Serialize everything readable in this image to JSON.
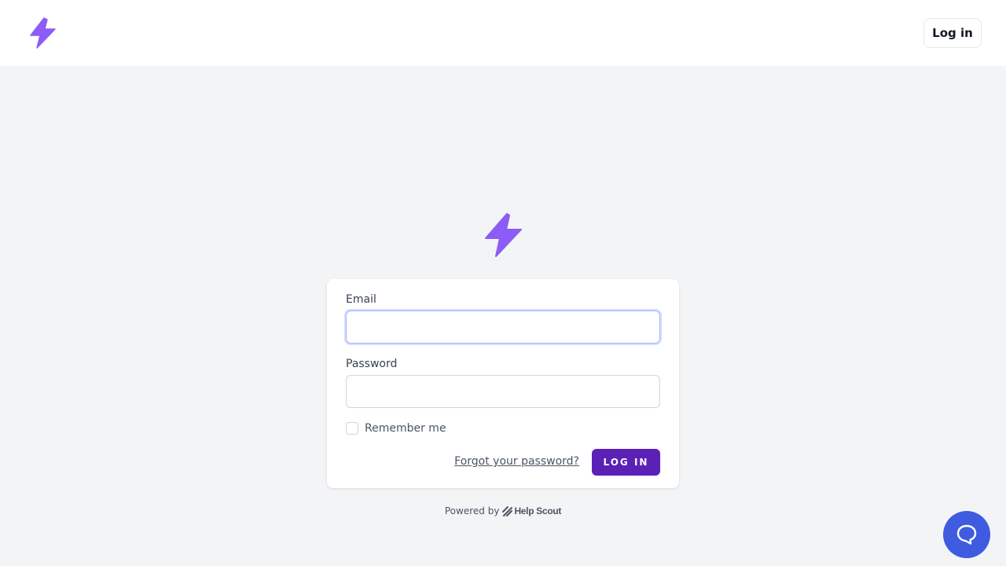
{
  "header": {
    "logo_icon": "lightning-bolt-icon",
    "login_label": "Log in"
  },
  "form": {
    "logo_icon": "lightning-bolt-icon",
    "email_label": "Email",
    "email_value": "",
    "password_label": "Password",
    "password_value": "",
    "remember_label": "Remember me",
    "remember_checked": false,
    "forgot_label": "Forgot your password?",
    "submit_label": "LOG IN"
  },
  "footer": {
    "powered_by": "Powered by",
    "brand": "Help Scout"
  },
  "help_widget": {
    "icon": "chat-bubble-icon"
  },
  "colors": {
    "accent": "#8b5cf6",
    "button": "#5b21b6",
    "help_widget": "#3f5ce0",
    "background": "#f3f4f6"
  }
}
